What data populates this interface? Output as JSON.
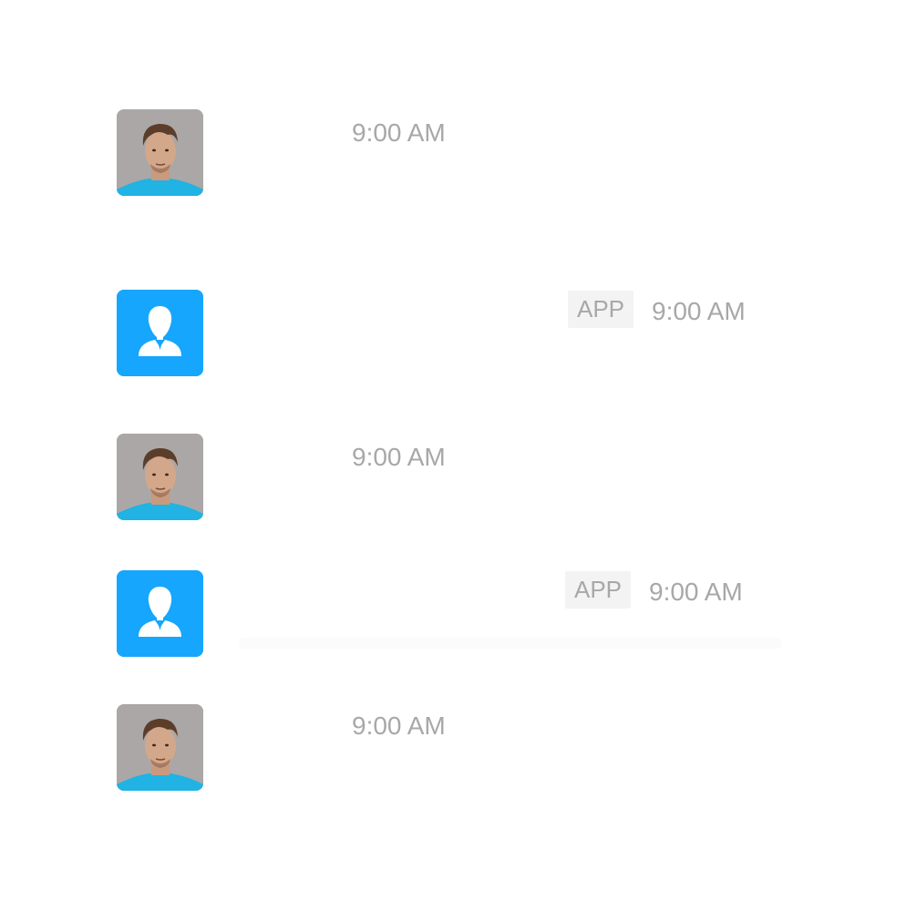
{
  "messages": [
    {
      "sender_type": "user",
      "avatar_icon": "user-photo-avatar",
      "time": "9:00 AM",
      "badge": ""
    },
    {
      "sender_type": "app",
      "avatar_icon": "app-person-avatar",
      "time": "9:00 AM",
      "badge": "APP"
    },
    {
      "sender_type": "user",
      "avatar_icon": "user-photo-avatar",
      "time": "9:00 AM",
      "badge": ""
    },
    {
      "sender_type": "app",
      "avatar_icon": "app-person-avatar",
      "time": "9:00 AM",
      "badge": "APP"
    },
    {
      "sender_type": "user",
      "avatar_icon": "user-photo-avatar",
      "time": "9:00 AM",
      "badge": ""
    }
  ],
  "colors": {
    "app_avatar_bg": "#16a6fd",
    "time_text": "#a8a8a8",
    "badge_bg": "#f3f3f3"
  }
}
